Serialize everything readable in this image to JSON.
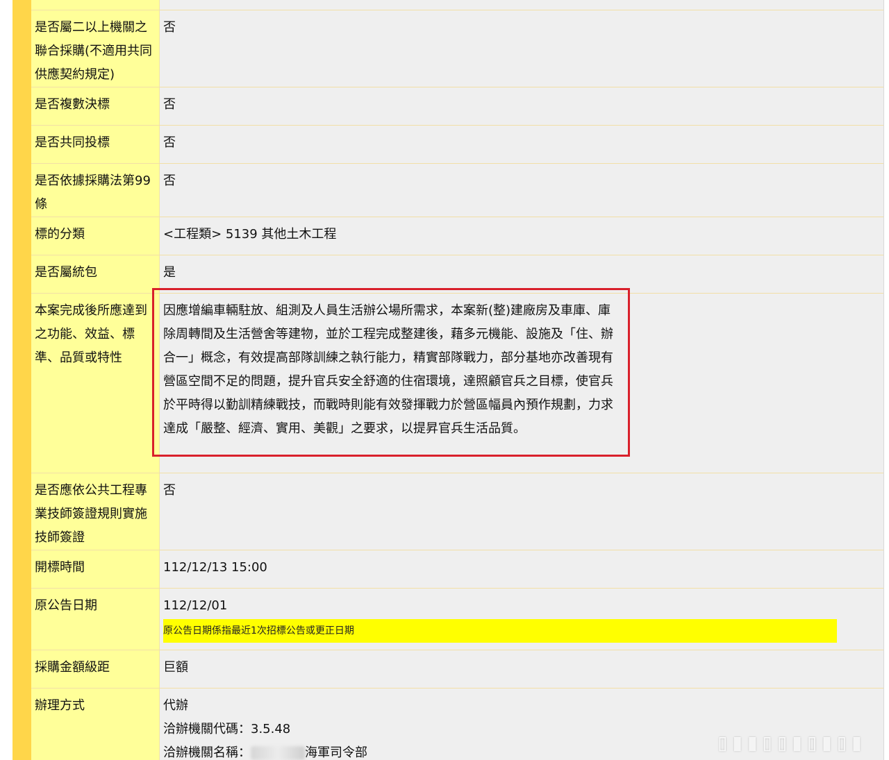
{
  "rows": [
    {
      "label": "是否屬二以上機關之聯合採購(不適用共同供應契約規定)",
      "value": "否"
    },
    {
      "label": "是否複數決標",
      "value": "否"
    },
    {
      "label": "是否共同投標",
      "value": "否"
    },
    {
      "label": "是否依據採購法第99條",
      "value": "否"
    },
    {
      "label": "標的分類",
      "value": "<工程類> 5139 其他土木工程"
    },
    {
      "label": "是否屬統包",
      "value": "是"
    },
    {
      "label": "本案完成後所應達到之功能、效益、標準、品質或特性",
      "value": "因應增編車輛駐放、組測及人員生活辦公場所需求，本案新(整)建廠房及車庫、庫除周轉間及生活營舍等建物，並於工程完成整建後，藉多元機能、設施及「住、辦合一」概念，有效提高部隊訓練之執行能力，精實部隊戰力，部分基地亦改善現有營區空間不足的問題，提升官兵安全舒適的住宿環境，達照顧官兵之目標，使官兵於平時得以勤訓精練戰技，而戰時則能有效發揮戰力於營區幅員內預作規劃，力求達成「嚴整、經濟、實用、美觀」之要求，以提昇官兵生活品質。"
    },
    {
      "label": "是否應依公共工程專業技師簽證規則實施技師簽證",
      "value": "否"
    },
    {
      "label": "開標時間",
      "value": "112/12/13 15:00"
    },
    {
      "label": "原公告日期",
      "value": "112/12/01",
      "note": "原公告日期係指最近1次招標公告或更正日期"
    },
    {
      "label": "採購金額級距",
      "value": "巨額"
    },
    {
      "label": "辦理方式",
      "value": "代辦",
      "agency_code": "洽辦機關代碼：3.5.48",
      "agency_name_prefix": "洽辦機關名稱：",
      "agency_name_suffix": "海軍司令部"
    }
  ],
  "watermark": "▯▮▮▯▯▮▯▮▯▮"
}
